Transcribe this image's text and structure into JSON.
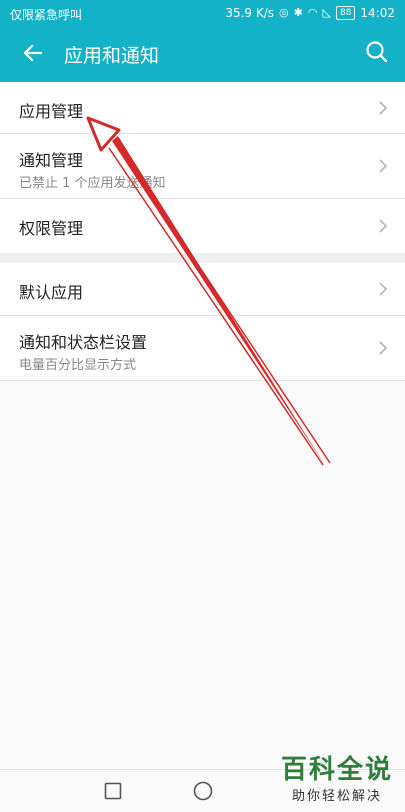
{
  "status_bar": {
    "carrier": "仅限紧急呼叫",
    "speed": "35.9 K/s",
    "battery": "88",
    "time": "14:02"
  },
  "app_bar": {
    "back_icon": "arrow-left-icon",
    "title": "应用和通知",
    "search_icon": "search-icon"
  },
  "settings": {
    "items": [
      {
        "label": "应用管理",
        "sub": ""
      },
      {
        "label": "通知管理",
        "sub": "已禁止 1 个应用发送通知"
      },
      {
        "label": "权限管理",
        "sub": ""
      },
      {
        "label": "默认应用",
        "sub": ""
      },
      {
        "label": "通知和状态栏设置",
        "sub": "电量百分比显示方式"
      }
    ]
  },
  "watermark": {
    "title": "百科全说",
    "subtitle": "助你轻松解决"
  },
  "colors": {
    "accent": "#14b2c7",
    "annotation_arrow": "#d42a2a"
  }
}
